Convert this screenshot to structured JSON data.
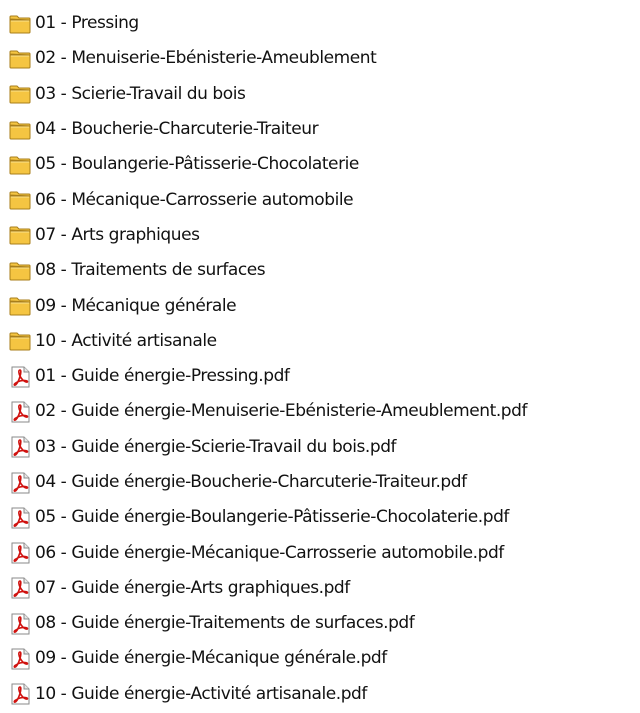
{
  "colors": {
    "folder_fill": "#f5c542",
    "folder_outline": "#a87e1a",
    "pdf_red": "#d0120f",
    "text": "#111111",
    "background": "#ffffff"
  },
  "items": [
    {
      "type": "folder",
      "icon": "folder-icon",
      "label": "01 - Pressing"
    },
    {
      "type": "folder",
      "icon": "folder-icon",
      "label": "02 - Menuiserie-Ebénisterie-Ameublement"
    },
    {
      "type": "folder",
      "icon": "folder-icon",
      "label": "03 - Scierie-Travail du bois"
    },
    {
      "type": "folder",
      "icon": "folder-icon",
      "label": "04 - Boucherie-Charcuterie-Traiteur"
    },
    {
      "type": "folder",
      "icon": "folder-icon",
      "label": "05 - Boulangerie-Pâtisserie-Chocolaterie"
    },
    {
      "type": "folder",
      "icon": "folder-icon",
      "label": "06 - Mécanique-Carrosserie automobile"
    },
    {
      "type": "folder",
      "icon": "folder-icon",
      "label": "07 - Arts graphiques"
    },
    {
      "type": "folder",
      "icon": "folder-icon",
      "label": "08 - Traitements de surfaces"
    },
    {
      "type": "folder",
      "icon": "folder-icon",
      "label": "09 - Mécanique générale"
    },
    {
      "type": "folder",
      "icon": "folder-icon",
      "label": "10 - Activité artisanale"
    },
    {
      "type": "pdf",
      "icon": "pdf-file-icon",
      "label": "01 - Guide énergie-Pressing.pdf"
    },
    {
      "type": "pdf",
      "icon": "pdf-file-icon",
      "label": "02 - Guide énergie-Menuiserie-Ebénisterie-Ameublement.pdf"
    },
    {
      "type": "pdf",
      "icon": "pdf-file-icon",
      "label": "03 - Guide énergie-Scierie-Travail du bois.pdf"
    },
    {
      "type": "pdf",
      "icon": "pdf-file-icon",
      "label": "04 - Guide énergie-Boucherie-Charcuterie-Traiteur.pdf"
    },
    {
      "type": "pdf",
      "icon": "pdf-file-icon",
      "label": "05 - Guide énergie-Boulangerie-Pâtisserie-Chocolaterie.pdf"
    },
    {
      "type": "pdf",
      "icon": "pdf-file-icon",
      "label": "06 - Guide énergie-Mécanique-Carrosserie automobile.pdf"
    },
    {
      "type": "pdf",
      "icon": "pdf-file-icon",
      "label": "07 - Guide énergie-Arts graphiques.pdf"
    },
    {
      "type": "pdf",
      "icon": "pdf-file-icon",
      "label": "08 - Guide énergie-Traitements de surfaces.pdf"
    },
    {
      "type": "pdf",
      "icon": "pdf-file-icon",
      "label": "09 - Guide énergie-Mécanique générale.pdf"
    },
    {
      "type": "pdf",
      "icon": "pdf-file-icon",
      "label": "10 - Guide énergie-Activité artisanale.pdf"
    }
  ]
}
